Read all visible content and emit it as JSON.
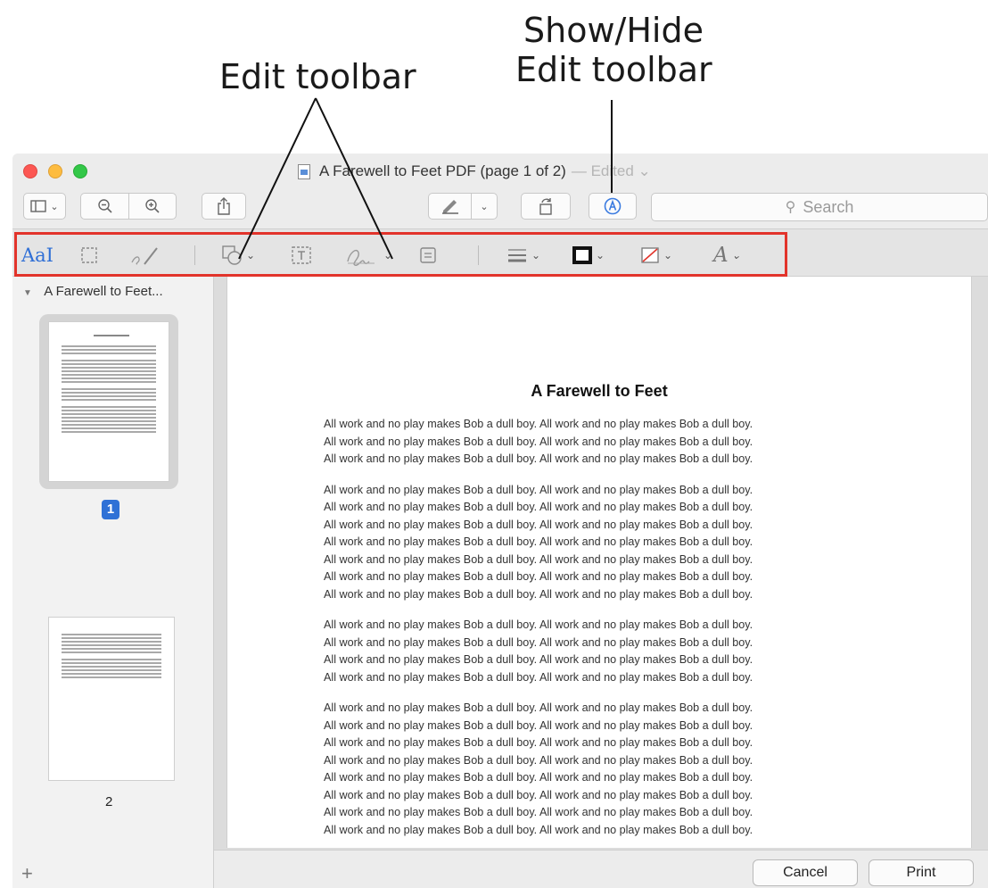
{
  "annotations": {
    "edit_toolbar": "Edit toolbar",
    "show_hide_line1": "Show/Hide",
    "show_hide_line2": "Edit toolbar"
  },
  "window": {
    "title": "A Farewell to Feet PDF (page 1 of 2)",
    "edited": "— Edited",
    "edited_chevron": "⌄"
  },
  "toolbar": {
    "search_placeholder": "Search",
    "icons": [
      "sidebar-view-icon",
      "zoom-out-icon",
      "zoom-in-icon",
      "share-icon",
      "highlight-pen-icon",
      "rotate-icon",
      "markup-icon",
      "search-icon"
    ]
  },
  "edit_toolbar": {
    "text_selection_label": "AaI",
    "icons": [
      "text-selection-icon",
      "rectangular-selection-icon",
      "sketch-icon",
      "shapes-icon",
      "text-box-icon",
      "sign-icon",
      "note-icon",
      "shape-style-icon",
      "border-color-icon",
      "fill-color-icon",
      "text-style-icon"
    ],
    "highlight_color": "#e2342b"
  },
  "sidebar": {
    "document_name": "A Farewell to Feet...",
    "pages": [
      {
        "number": "1",
        "selected": true
      },
      {
        "number": "2",
        "selected": false
      }
    ],
    "add_label": "+"
  },
  "document": {
    "title": "A Farewell to Feet",
    "line_text": "All work and no play makes Bob a dull boy. All work and no play makes Bob a dull boy.",
    "paragraph_line_counts": [
      3,
      7,
      4,
      8
    ]
  },
  "bottom_bar": {
    "cancel_label": "Cancel",
    "print_label": "Print"
  }
}
